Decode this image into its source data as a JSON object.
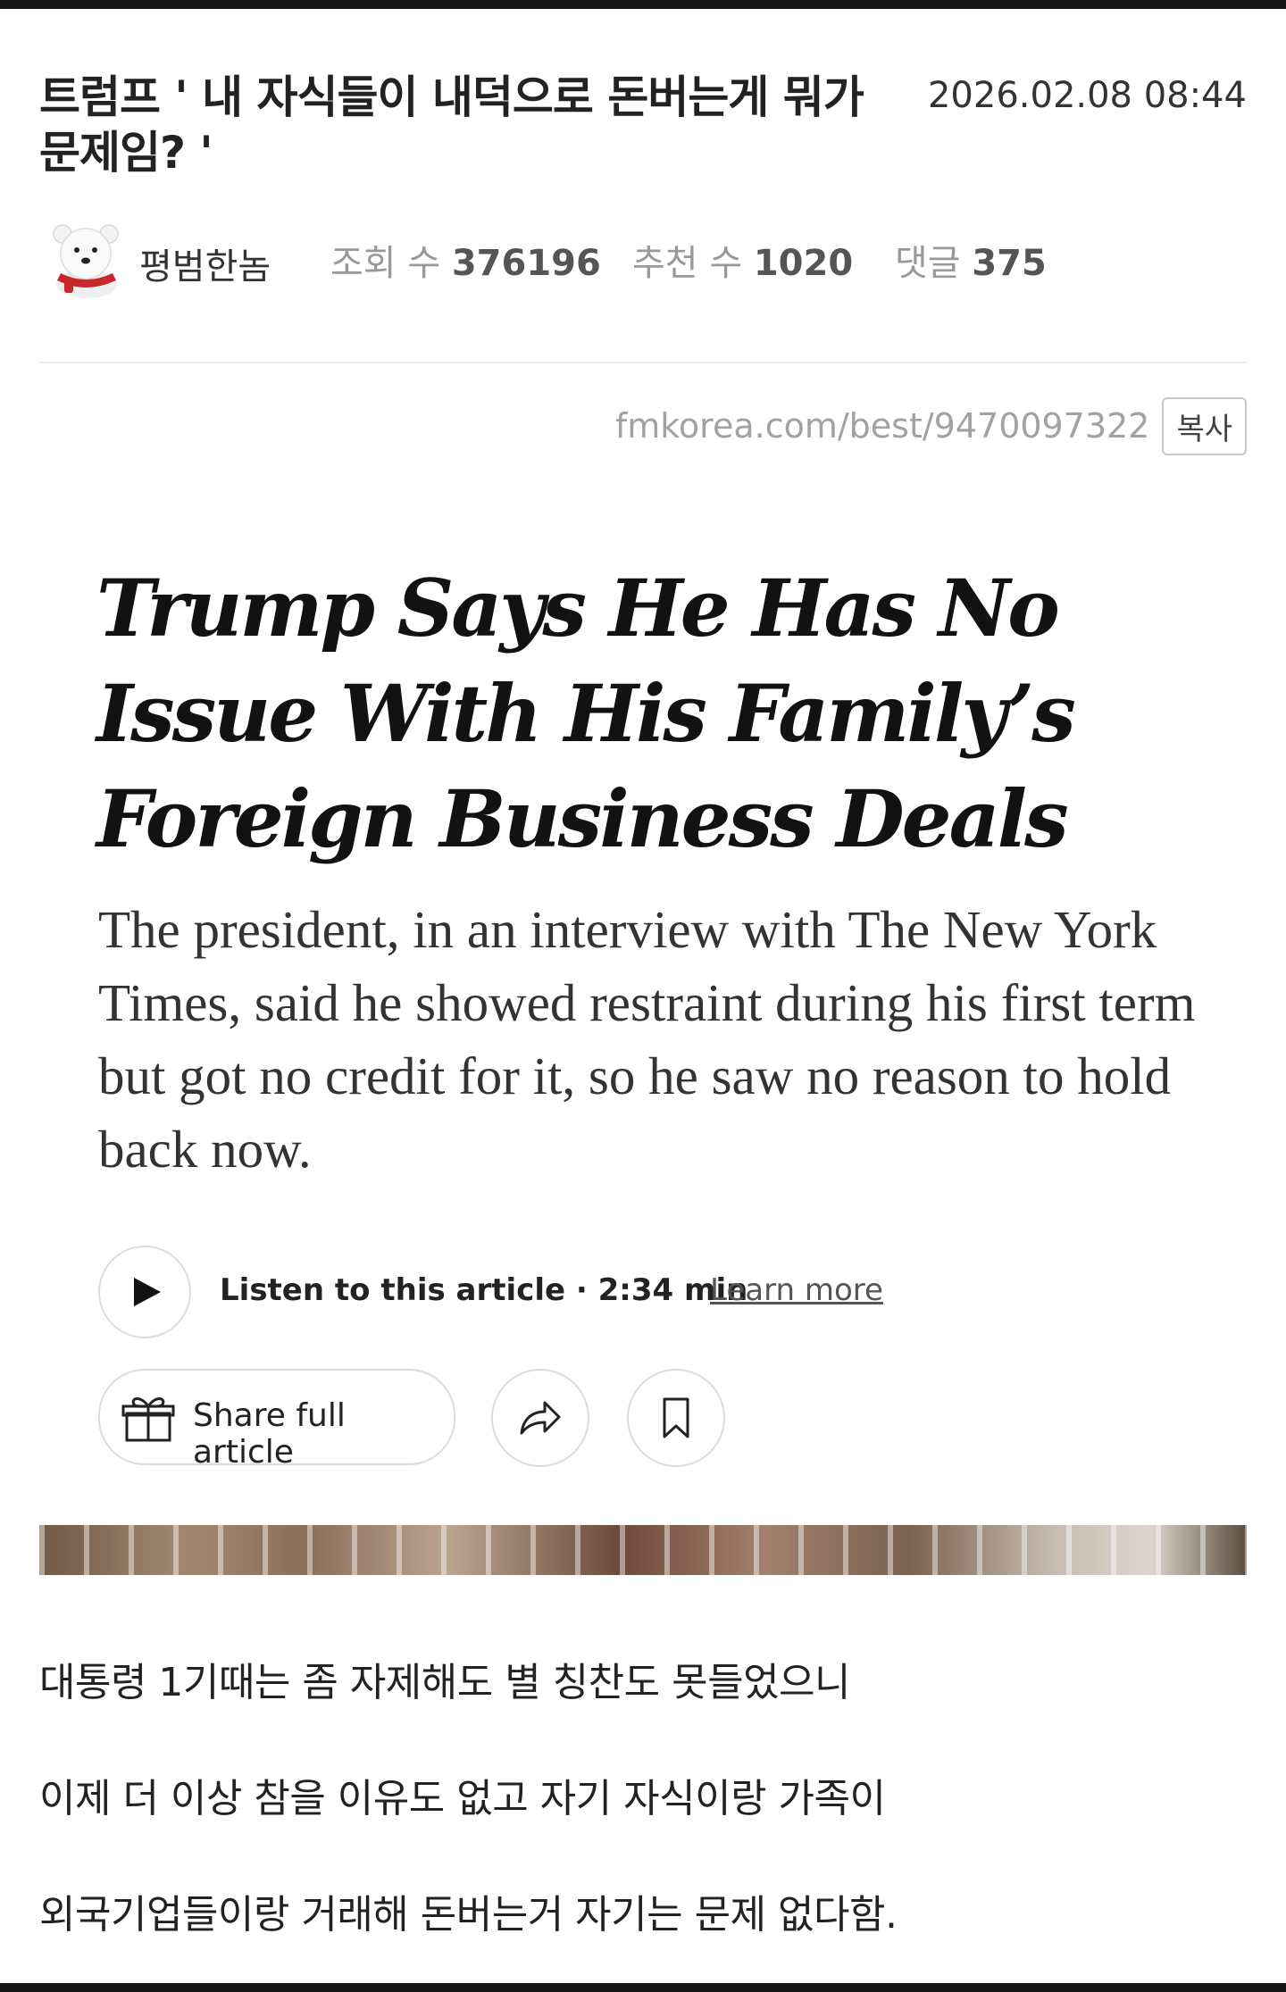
{
  "post": {
    "title": "트럼프 ' 내 자식들이 내덕으로 돈버는게 뭐가 문제임? '",
    "date": "2026.02.08 08:44",
    "author": "평범한놈",
    "views_label": "조회 수",
    "views": "376196",
    "likes_label": "추천 수",
    "likes": "1020",
    "comments_label": "댓글",
    "comments": "375",
    "url": "fmkorea.com/best/9470097322",
    "copy_label": "복사"
  },
  "article": {
    "headline": "Trump Says He Has No Issue With His Family’s Foreign Business Deals",
    "summary": "The president, in an interview with The New York Times, said he showed restraint during his first term but got no credit for it, so he saw no reason to hold back now.",
    "listen_label": "Listen to this article · 2:34 min",
    "learn_more_label": "Learn more",
    "share_label": "Share full article"
  },
  "body": {
    "lines": [
      "대통령 1기때는 좀 자제해도 별 칭찬도 못들었으니",
      "이제 더 이상 참을 이유도 없고 자기 자식이랑 가족이",
      "외국기업들이랑 거래해 돈버는거 자기는 문제 없다함."
    ]
  },
  "icons": {
    "avatar": "polar-bear-avatar",
    "play": "play-icon",
    "gift": "gift-icon",
    "share": "share-arrow-icon",
    "bookmark": "bookmark-icon"
  }
}
